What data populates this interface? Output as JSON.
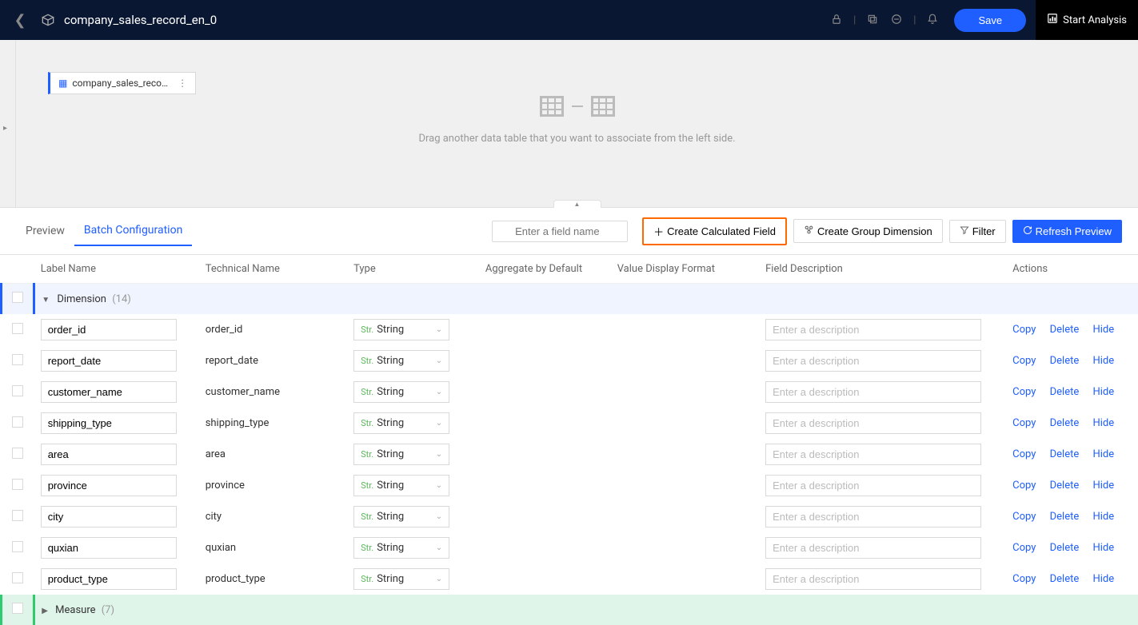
{
  "header": {
    "title": "company_sales_record_en_0",
    "save_label": "Save",
    "start_analysis_label": "Start Analysis"
  },
  "canvas": {
    "chip_label": "company_sales_reco…",
    "hint": "Drag another data table that you want to associate from the left side."
  },
  "tabs": {
    "preview": "Preview",
    "batch_config": "Batch Configuration"
  },
  "toolbar": {
    "search_placeholder": "Enter a field name",
    "create_calc_field": "Create Calculated Field",
    "create_group_dim": "Create Group Dimension",
    "filter": "Filter",
    "refresh_preview": "Refresh Preview"
  },
  "columns": {
    "label_name": "Label Name",
    "technical_name": "Technical Name",
    "type": "Type",
    "aggregate": "Aggregate by Default",
    "value_format": "Value Display Format",
    "field_desc": "Field Description",
    "actions": "Actions"
  },
  "groups": {
    "dimension_label": "Dimension",
    "dimension_count": "(14)",
    "measure_label": "Measure",
    "measure_count": "(7)"
  },
  "type_prefix": "Str.",
  "type_value": "String",
  "desc_placeholder": "Enter a description",
  "action_labels": {
    "copy": "Copy",
    "delete": "Delete",
    "hide": "Hide"
  },
  "fields": [
    {
      "label": "order_id",
      "tech": "order_id"
    },
    {
      "label": "report_date",
      "tech": "report_date"
    },
    {
      "label": "customer_name",
      "tech": "customer_name"
    },
    {
      "label": "shipping_type",
      "tech": "shipping_type"
    },
    {
      "label": "area",
      "tech": "area"
    },
    {
      "label": "province",
      "tech": "province"
    },
    {
      "label": "city",
      "tech": "city"
    },
    {
      "label": "quxian",
      "tech": "quxian"
    },
    {
      "label": "product_type",
      "tech": "product_type"
    }
  ]
}
